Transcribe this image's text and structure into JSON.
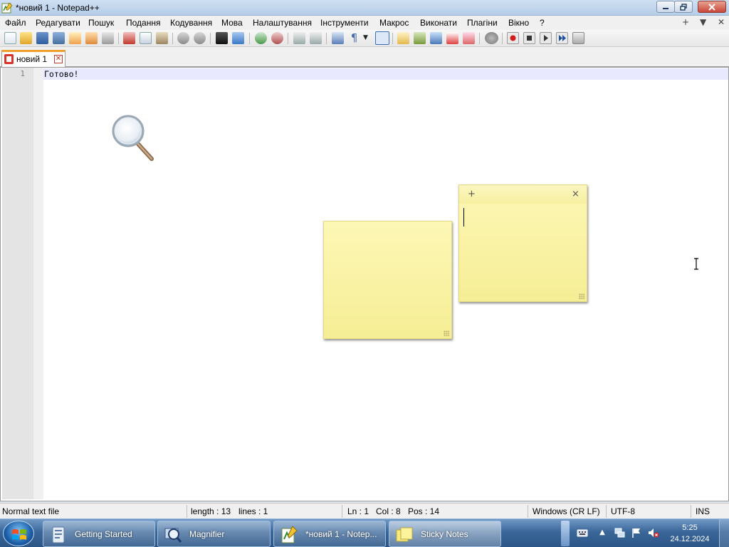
{
  "window": {
    "title": "*новий 1 - Notepad++"
  },
  "menu": {
    "items": [
      "Файл",
      "Редагувати",
      "Пошук",
      "Подання",
      "Кодування",
      "Мова",
      "Налаштування",
      "Інструменти",
      "Макрос",
      "Виконати",
      "Плагіни",
      "Вікно",
      "?"
    ],
    "right_controls": [
      "+",
      "▼",
      "✕"
    ]
  },
  "toolbar": {
    "icons": [
      "new-file-icon",
      "open-file-icon",
      "save-icon",
      "save-all-icon",
      "close-icon",
      "close-all-icon",
      "print-icon",
      "cut-icon",
      "copy-icon",
      "paste-icon",
      "undo-icon",
      "redo-icon",
      "find-icon",
      "replace-icon",
      "zoom-in-icon",
      "zoom-out-icon",
      "sync-vertical-icon",
      "sync-horizontal-icon",
      "word-wrap-icon",
      "show-all-chars-icon",
      "indent-guide-icon",
      "document-map-icon",
      "function-list-icon",
      "folder-workspace-icon",
      "monitoring-icon",
      "record-macro-icon",
      "stop-macro-icon",
      "play-macro-icon",
      "run-macro-multiple-icon",
      "save-macro-icon"
    ]
  },
  "tab": {
    "label": "новий 1",
    "close": "⊠"
  },
  "editor": {
    "line_number": "1",
    "text": "Готово!"
  },
  "sticky_note": {
    "add": "+",
    "close": "×"
  },
  "statusbar": {
    "file_type": "Normal text file",
    "length": "length : 13",
    "lines": "lines : 1",
    "ln": "Ln : 1",
    "col": "Col : 8",
    "pos": "Pos : 14",
    "eol": "Windows (CR LF)",
    "encoding": "UTF-8",
    "mode": "INS"
  },
  "taskbar": {
    "tasks": [
      {
        "label": "Getting Started",
        "icon": "getting-started-icon"
      },
      {
        "label": "Magnifier",
        "icon": "magnifier-icon"
      },
      {
        "label": "*новий 1 - Notep...",
        "icon": "notepadpp-icon"
      },
      {
        "label": "Sticky Notes",
        "icon": "sticky-notes-icon"
      }
    ],
    "clock": {
      "time": "5:25",
      "date": "24.12.2024"
    }
  }
}
